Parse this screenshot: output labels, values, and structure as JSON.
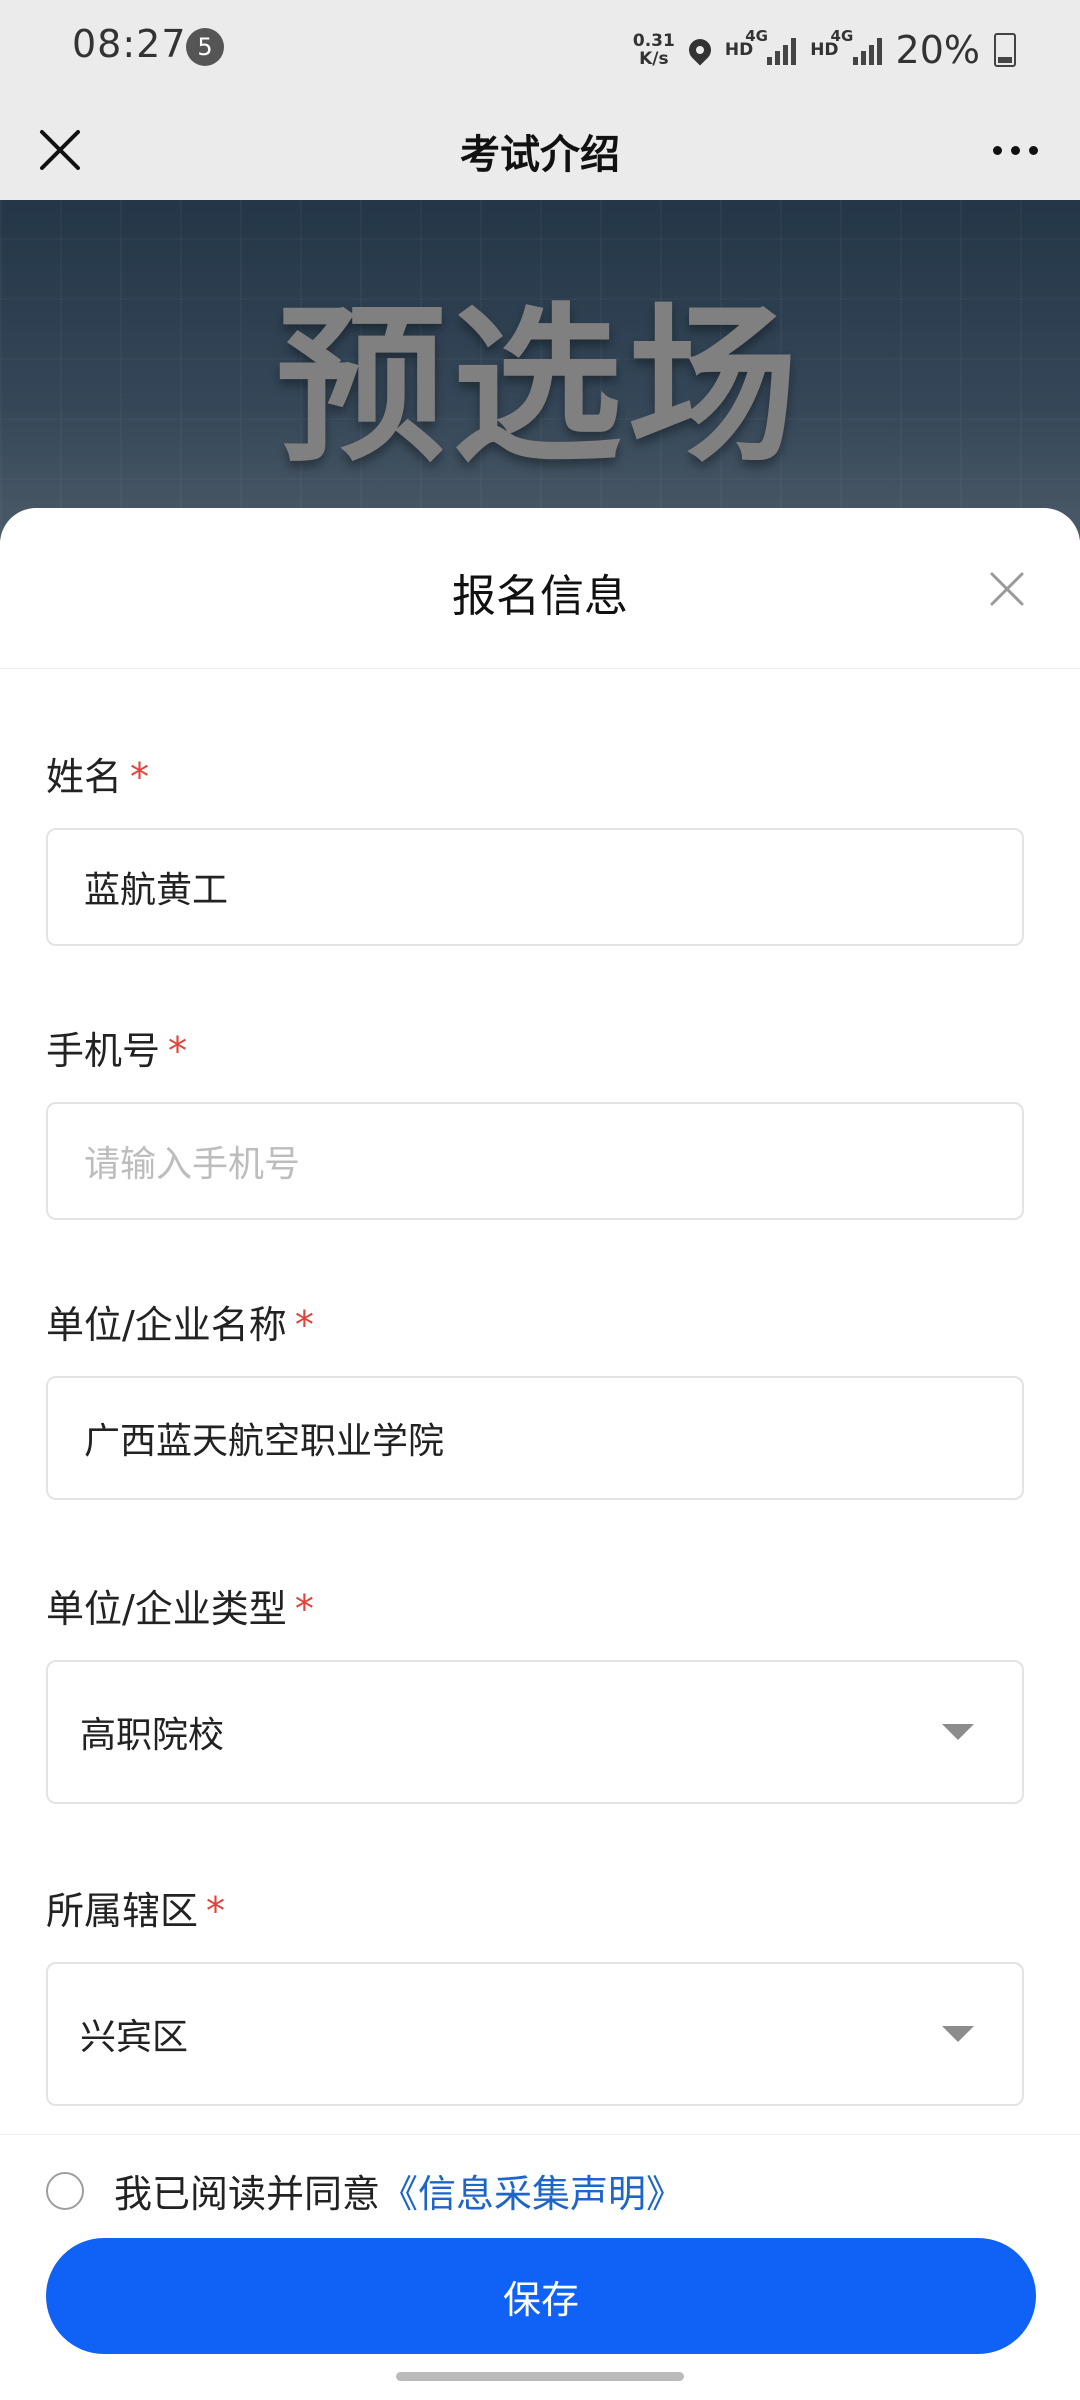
{
  "status_bar": {
    "time": "08:27",
    "notification_count": "5",
    "net_speed_value": "0.31",
    "net_speed_unit": "K/s",
    "hd1": "HD",
    "gen1": "4G",
    "hd2": "HD",
    "gen2": "4G",
    "battery": "20%"
  },
  "nav": {
    "title": "考试介绍"
  },
  "banner": {
    "headline": "预选场"
  },
  "sheet": {
    "title": "报名信息",
    "required_mark": "*",
    "fields": {
      "name": {
        "label": "姓名",
        "value": "蓝航黄工"
      },
      "phone": {
        "label": "手机号",
        "placeholder": "请输入手机号"
      },
      "company": {
        "label": "单位/企业名称",
        "value": "广西蓝天航空职业学院"
      },
      "company_type": {
        "label": "单位/企业类型",
        "value": "高职院校"
      },
      "district": {
        "label": "所属辖区",
        "value": "兴宾区"
      }
    }
  },
  "footer": {
    "agree_text": "我已阅读并同意",
    "agree_link": "《信息采集声明》",
    "save_label": "保存"
  },
  "colors": {
    "accent": "#1061f5",
    "link": "#1d66c8",
    "required": "#e0433b"
  }
}
